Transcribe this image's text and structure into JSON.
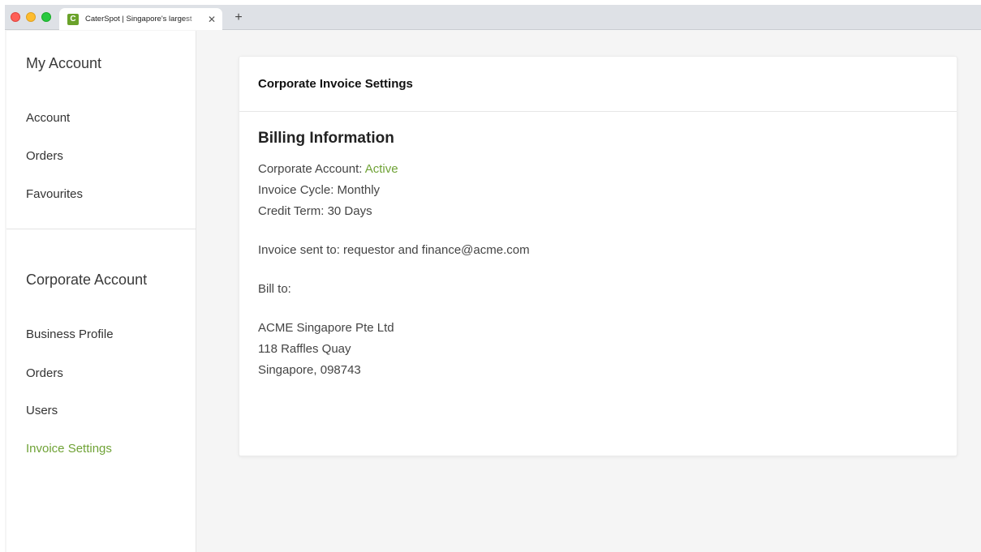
{
  "browser": {
    "tab_title": "CaterSpot | Singapore's largest",
    "tab_close": "✕",
    "favicon_letter": "C",
    "new_tab": "+"
  },
  "sidebar": {
    "my_account_heading": "My Account",
    "my_account_items": [
      {
        "label": "Account"
      },
      {
        "label": "Orders"
      },
      {
        "label": "Favourites"
      }
    ],
    "corporate_heading": "Corporate Account",
    "corporate_items": [
      {
        "label": "Business Profile"
      },
      {
        "label": "Orders"
      },
      {
        "label": "Users"
      },
      {
        "label": "Invoice Settings",
        "active": true
      }
    ]
  },
  "card": {
    "title": "Corporate Invoice Settings",
    "section_title": "Billing Information",
    "corporate_account_label": "Corporate Account: ",
    "corporate_account_status": "Active",
    "invoice_cycle": "Invoice Cycle: Monthly",
    "credit_term": "Credit Term: 30 Days",
    "invoice_sent_to": "Invoice sent to: requestor and finance@acme.com",
    "bill_to_label": "Bill to:",
    "address_lines": [
      "ACME Singapore Pte Ltd",
      "118 Raffles Quay",
      "Singapore, 098743"
    ]
  },
  "colors": {
    "accent_green": "#6fa236",
    "favicon_green": "#6aa22a",
    "page_background": "#f5f5f5"
  }
}
